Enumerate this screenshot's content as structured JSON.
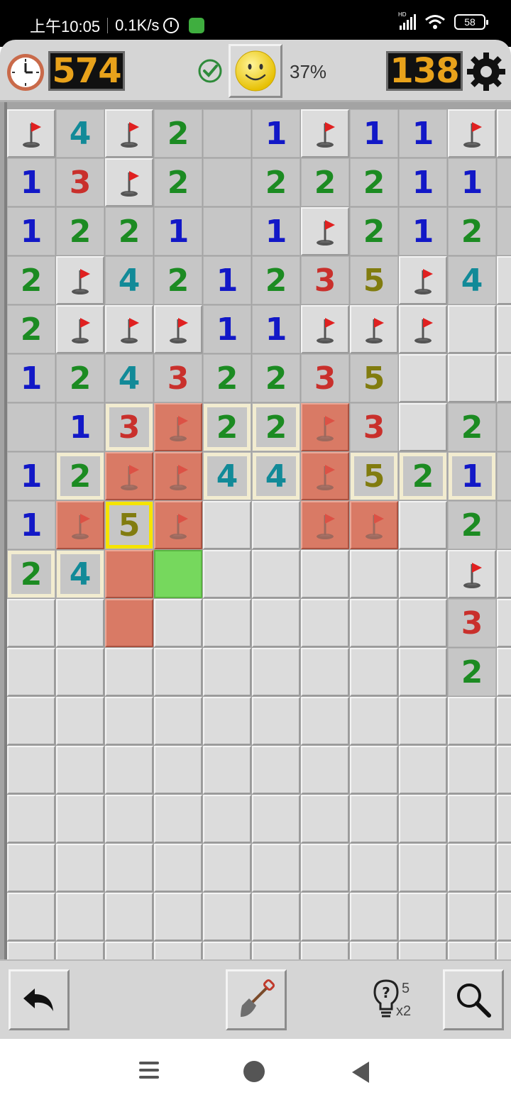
{
  "status_bar": {
    "time": "上午10:05",
    "network_speed": "0.1K/s",
    "battery": "58",
    "signal_label": "HD"
  },
  "header": {
    "timer": "574",
    "mines_remaining": "138",
    "progress": "37%",
    "icons": [
      "clock-icon",
      "check-icon",
      "smiley-face-icon",
      "gear-icon"
    ]
  },
  "board": {
    "legend": {
      "F": "flag",
      "R": "flag on red (wrong-area) cell",
      "C": "closed",
      "O": "open empty",
      "X": "red cell no flag",
      "G": "green cell",
      "digits": "open number",
      "suffix_h": "highlighted hint border",
      "suffix_s": "selected yellow border"
    },
    "colors": {
      "1": "#1218c7",
      "2": "#1c8b22",
      "3": "#c9302c",
      "4": "#128a98",
      "5": "#817c0f",
      "red_cell": "#d97a65",
      "green_cell": "#76d85d"
    },
    "rows": [
      [
        "F",
        "4",
        "F",
        "2",
        "O",
        "1",
        "F",
        "1",
        "1",
        "F",
        "C"
      ],
      [
        "1",
        "3",
        "F",
        "2",
        "O",
        "2",
        "2",
        "2",
        "1",
        "1",
        "O"
      ],
      [
        "1",
        "2",
        "2",
        "1",
        "O",
        "1",
        "F",
        "2",
        "1",
        "2",
        "O"
      ],
      [
        "2",
        "F",
        "4",
        "2",
        "1",
        "2",
        "3",
        "5",
        "F",
        "4",
        "F"
      ],
      [
        "2",
        "F",
        "F",
        "F",
        "1",
        "1",
        "F",
        "F",
        "F",
        "C",
        "C"
      ],
      [
        "1",
        "2",
        "4",
        "3",
        "2",
        "2",
        "3",
        "5",
        "C",
        "C",
        "C"
      ],
      [
        "O",
        "1",
        "3h",
        "R",
        "2h",
        "2h",
        "R",
        "3",
        "C",
        "2",
        "O"
      ],
      [
        "1",
        "2h",
        "R",
        "R",
        "4h",
        "4h",
        "R",
        "5h",
        "2h",
        "1h",
        "O"
      ],
      [
        "1",
        "R",
        "5s",
        "R",
        "C",
        "C",
        "R",
        "R",
        "C",
        "2",
        "O"
      ],
      [
        "2h",
        "4h",
        "X",
        "G",
        "C",
        "C",
        "C",
        "C",
        "C",
        "F",
        "C"
      ],
      [
        "C",
        "C",
        "X",
        "C",
        "C",
        "C",
        "C",
        "C",
        "C",
        "3",
        "C"
      ],
      [
        "C",
        "C",
        "C",
        "C",
        "C",
        "C",
        "C",
        "C",
        "C",
        "2",
        "C"
      ],
      [
        "C",
        "C",
        "C",
        "C",
        "C",
        "C",
        "C",
        "C",
        "C",
        "C",
        "C"
      ],
      [
        "C",
        "C",
        "C",
        "C",
        "C",
        "C",
        "C",
        "C",
        "C",
        "C",
        "C"
      ],
      [
        "C",
        "C",
        "C",
        "C",
        "C",
        "C",
        "C",
        "C",
        "C",
        "C",
        "C"
      ],
      [
        "C",
        "C",
        "C",
        "C",
        "C",
        "C",
        "C",
        "C",
        "C",
        "C",
        "C"
      ],
      [
        "C",
        "C",
        "C",
        "C",
        "C",
        "C",
        "C",
        "C",
        "C",
        "C",
        "C"
      ],
      [
        "C",
        "C",
        "C",
        "C",
        "C",
        "C",
        "C",
        "C",
        "C",
        "C",
        "C"
      ]
    ]
  },
  "toolbar": {
    "hint_count": "5",
    "hint_multiplier": "x2",
    "icons": [
      "undo-icon",
      "shovel-icon",
      "lightbulb-hint-icon",
      "magnifier-icon"
    ]
  },
  "navbar": {
    "icons": [
      "menu-icon",
      "home-icon",
      "back-icon"
    ]
  }
}
